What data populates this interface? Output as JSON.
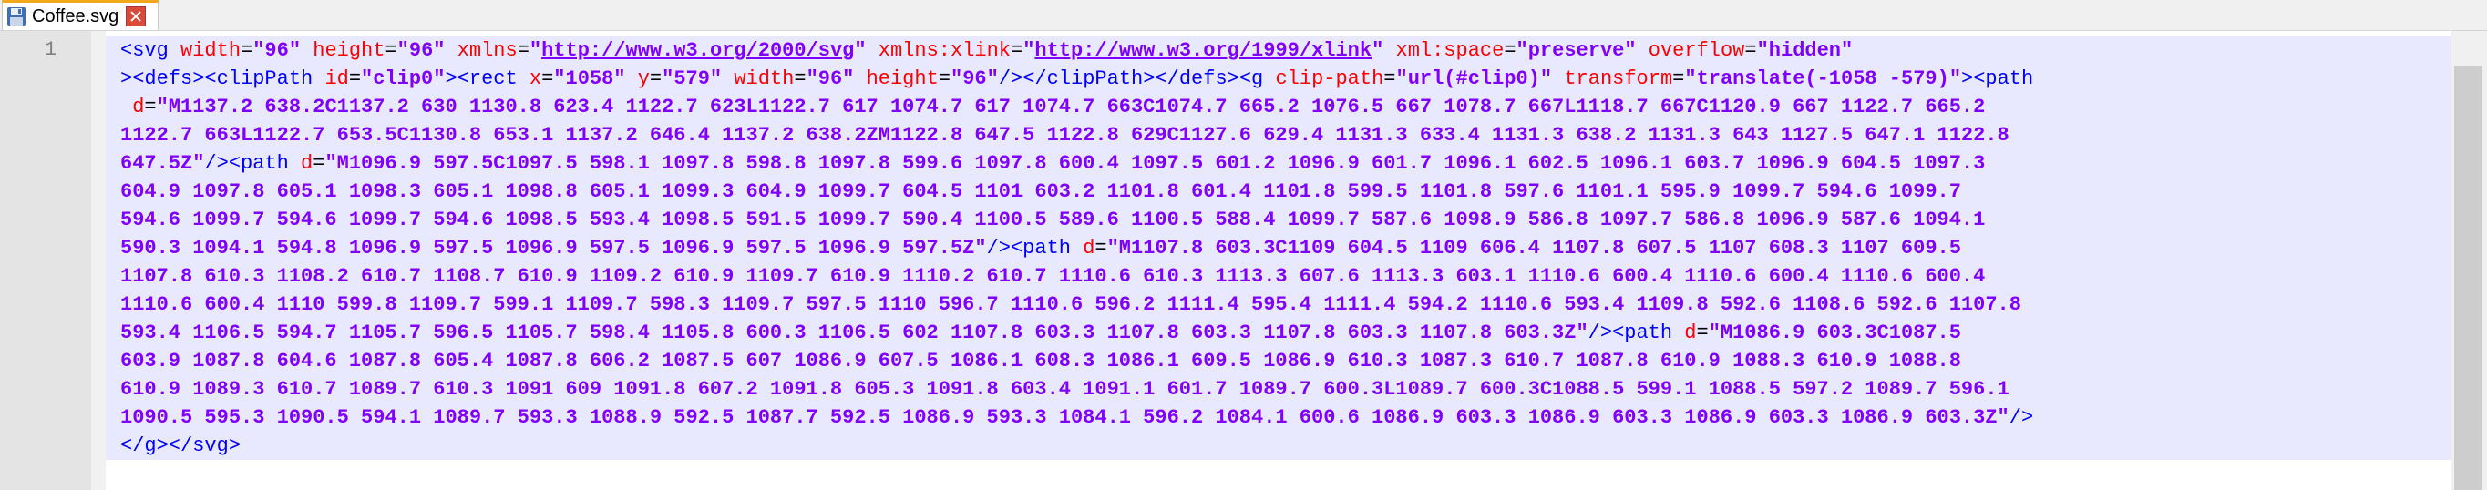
{
  "tab": {
    "title": "Coffee.svg",
    "icon": "save-disk-icon",
    "close_icon": "close-icon",
    "accent": "#f3a81c"
  },
  "editor": {
    "line_number": "1",
    "lines": [
      [
        [
          "t-tag",
          "<svg "
        ],
        [
          "t-attr",
          "width"
        ],
        [
          "t-punc",
          "="
        ],
        [
          "t-val",
          "\"96\""
        ],
        [
          "t-punc",
          " "
        ],
        [
          "t-attr",
          "height"
        ],
        [
          "t-punc",
          "="
        ],
        [
          "t-val",
          "\"96\""
        ],
        [
          "t-punc",
          " "
        ],
        [
          "t-attr",
          "xmlns"
        ],
        [
          "t-punc",
          "="
        ],
        [
          "t-val",
          "\""
        ],
        [
          "t-url",
          "http://www.w3.org/2000/svg"
        ],
        [
          "t-val",
          "\""
        ],
        [
          "t-punc",
          " "
        ],
        [
          "t-attr",
          "xmlns:xlink"
        ],
        [
          "t-punc",
          "="
        ],
        [
          "t-val",
          "\""
        ],
        [
          "t-url",
          "http://www.w3.org/1999/xlink"
        ],
        [
          "t-val",
          "\""
        ],
        [
          "t-punc",
          " "
        ],
        [
          "t-attr",
          "xml:space"
        ],
        [
          "t-punc",
          "="
        ],
        [
          "t-val",
          "\"preserve\""
        ],
        [
          "t-punc",
          " "
        ],
        [
          "t-attr",
          "overflow"
        ],
        [
          "t-punc",
          "="
        ],
        [
          "t-val",
          "\"hidden\""
        ]
      ],
      [
        [
          "t-tag",
          "><defs><clipPath "
        ],
        [
          "t-attr",
          "id"
        ],
        [
          "t-punc",
          "="
        ],
        [
          "t-val",
          "\"clip0\""
        ],
        [
          "t-tag",
          "><rect "
        ],
        [
          "t-attr",
          "x"
        ],
        [
          "t-punc",
          "="
        ],
        [
          "t-val",
          "\"1058\""
        ],
        [
          "t-punc",
          " "
        ],
        [
          "t-attr",
          "y"
        ],
        [
          "t-punc",
          "="
        ],
        [
          "t-val",
          "\"579\""
        ],
        [
          "t-punc",
          " "
        ],
        [
          "t-attr",
          "width"
        ],
        [
          "t-punc",
          "="
        ],
        [
          "t-val",
          "\"96\""
        ],
        [
          "t-punc",
          " "
        ],
        [
          "t-attr",
          "height"
        ],
        [
          "t-punc",
          "="
        ],
        [
          "t-val",
          "\"96\""
        ],
        [
          "t-tag",
          "/></clipPath></defs><g "
        ],
        [
          "t-attr",
          "clip-path"
        ],
        [
          "t-punc",
          "="
        ],
        [
          "t-val",
          "\"url(#clip0)\""
        ],
        [
          "t-punc",
          " "
        ],
        [
          "t-attr",
          "transform"
        ],
        [
          "t-punc",
          "="
        ],
        [
          "t-val",
          "\"translate(-1058 -579)\""
        ],
        [
          "t-tag",
          "><path"
        ]
      ],
      [
        [
          "t-punc",
          " "
        ],
        [
          "t-attr",
          "d"
        ],
        [
          "t-punc",
          "="
        ],
        [
          "t-val",
          "\"M1137.2 638.2C1137.2 630 1130.8 623.4 1122.7 623L1122.7 617 1074.7 617 1074.7 663C1074.7 665.2 1076.5 667 1078.7 667L1118.7 667C1120.9 667 1122.7 665.2"
        ]
      ],
      [
        [
          "t-val",
          "1122.7 663L1122.7 653.5C1130.8 653.1 1137.2 646.4 1137.2 638.2ZM1122.8 647.5 1122.8 629C1127.6 629.4 1131.3 633.4 1131.3 638.2 1131.3 643 1127.5 647.1 1122.8"
        ]
      ],
      [
        [
          "t-val",
          "647.5Z\""
        ],
        [
          "t-tag",
          "/><path "
        ],
        [
          "t-attr",
          "d"
        ],
        [
          "t-punc",
          "="
        ],
        [
          "t-val",
          "\"M1096.9 597.5C1097.5 598.1 1097.8 598.8 1097.8 599.6 1097.8 600.4 1097.5 601.2 1096.9 601.7 1096.1 602.5 1096.1 603.7 1096.9 604.5 1097.3"
        ]
      ],
      [
        [
          "t-val",
          "604.9 1097.8 605.1 1098.3 605.1 1098.8 605.1 1099.3 604.9 1099.7 604.5 1101 603.2 1101.8 601.4 1101.8 599.5 1101.8 597.6 1101.1 595.9 1099.7 594.6 1099.7"
        ]
      ],
      [
        [
          "t-val",
          "594.6 1099.7 594.6 1099.7 594.6 1098.5 593.4 1098.5 591.5 1099.7 590.4 1100.5 589.6 1100.5 588.4 1099.7 587.6 1098.9 586.8 1097.7 586.8 1096.9 587.6 1094.1"
        ]
      ],
      [
        [
          "t-val",
          "590.3 1094.1 594.8 1096.9 597.5 1096.9 597.5 1096.9 597.5 1096.9 597.5Z\""
        ],
        [
          "t-tag",
          "/><path "
        ],
        [
          "t-attr",
          "d"
        ],
        [
          "t-punc",
          "="
        ],
        [
          "t-val",
          "\"M1107.8 603.3C1109 604.5 1109 606.4 1107.8 607.5 1107 608.3 1107 609.5"
        ]
      ],
      [
        [
          "t-val",
          "1107.8 610.3 1108.2 610.7 1108.7 610.9 1109.2 610.9 1109.7 610.9 1110.2 610.7 1110.6 610.3 1113.3 607.6 1113.3 603.1 1110.6 600.4 1110.6 600.4 1110.6 600.4"
        ]
      ],
      [
        [
          "t-val",
          "1110.6 600.4 1110 599.8 1109.7 599.1 1109.7 598.3 1109.7 597.5 1110 596.7 1110.6 596.2 1111.4 595.4 1111.4 594.2 1110.6 593.4 1109.8 592.6 1108.6 592.6 1107.8"
        ]
      ],
      [
        [
          "t-val",
          "593.4 1106.5 594.7 1105.7 596.5 1105.7 598.4 1105.8 600.3 1106.5 602 1107.8 603.3 1107.8 603.3 1107.8 603.3 1107.8 603.3Z\""
        ],
        [
          "t-tag",
          "/><path "
        ],
        [
          "t-attr",
          "d"
        ],
        [
          "t-punc",
          "="
        ],
        [
          "t-val",
          "\"M1086.9 603.3C1087.5"
        ]
      ],
      [
        [
          "t-val",
          "603.9 1087.8 604.6 1087.8 605.4 1087.8 606.2 1087.5 607 1086.9 607.5 1086.1 608.3 1086.1 609.5 1086.9 610.3 1087.3 610.7 1087.8 610.9 1088.3 610.9 1088.8"
        ]
      ],
      [
        [
          "t-val",
          "610.9 1089.3 610.7 1089.7 610.3 1091 609 1091.8 607.2 1091.8 605.3 1091.8 603.4 1091.1 601.7 1089.7 600.3L1089.7 600.3C1088.5 599.1 1088.5 597.2 1089.7 596.1"
        ]
      ],
      [
        [
          "t-val",
          "1090.5 595.3 1090.5 594.1 1089.7 593.3 1088.9 592.5 1087.7 592.5 1086.9 593.3 1084.1 596.2 1084.1 600.6 1086.9 603.3 1086.9 603.3 1086.9 603.3 1086.9 603.3Z\""
        ],
        [
          "t-tag",
          "/>"
        ]
      ],
      [
        [
          "t-tag",
          "</g></svg>"
        ]
      ]
    ]
  }
}
